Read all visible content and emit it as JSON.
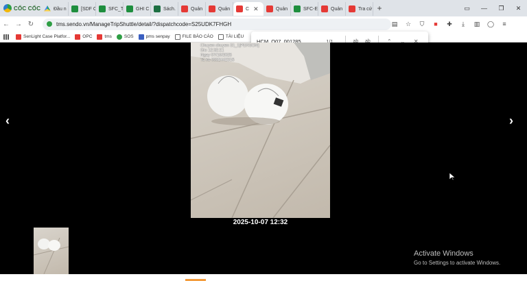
{
  "browser": {
    "brand": "CỐC CỐC",
    "tabs": [
      {
        "label": "Đầu n",
        "favicon": "drive-icon",
        "active": false
      },
      {
        "label": "[SDF C",
        "favicon": "sheets-icon",
        "active": false
      },
      {
        "label": "SFC_T",
        "favicon": "sheets-icon",
        "active": false
      },
      {
        "label": "GHI C",
        "favicon": "sheets-icon",
        "active": false
      },
      {
        "label": "Sách.",
        "favicon": "excel-icon",
        "active": false
      },
      {
        "label": "Quản",
        "favicon": "sendo-icon",
        "active": false
      },
      {
        "label": "Quản",
        "favicon": "sendo-icon",
        "active": false
      },
      {
        "label": "C",
        "favicon": "sendo-icon",
        "active": true
      },
      {
        "label": "Quản",
        "favicon": "sendo-icon",
        "active": false
      },
      {
        "label": "SFC-E",
        "favicon": "sheets-icon",
        "active": false
      },
      {
        "label": "Quản",
        "favicon": "sendo-icon",
        "active": false
      },
      {
        "label": "Tra cứ",
        "favicon": "sendo-icon",
        "active": false
      }
    ],
    "url": "tms.sendo.vn/ManageTripShuttle/detail/?dispatchcode=S25UDK7FHGH",
    "bookmarks": [
      {
        "label": "",
        "icon": "apps-grid-icon"
      },
      {
        "label": "SenLight Case Platfor...",
        "icon": "sendo-icon"
      },
      {
        "label": "OPC",
        "icon": "sendo-icon"
      },
      {
        "label": "tms",
        "icon": "sendo-icon"
      },
      {
        "label": "SOS",
        "icon": "spotify-icon"
      },
      {
        "label": "pms senpay",
        "icon": "senpay-icon"
      },
      {
        "label": "FILE BÁO CÁO",
        "icon": "folder-icon"
      },
      {
        "label": "TÀI LIỆU",
        "icon": "folder-icon"
      }
    ]
  },
  "find": {
    "query": "HCM_Q07_001285",
    "count": "1/1",
    "match_case": "ab",
    "whole_word": "ab"
  },
  "viewer": {
    "watermark": [
      "Chuyen chuyen 31_1[PERSON]",
      "Gio 12:32:21",
      "Ngay 07/10/2025",
      "Ta ke 0332442316"
    ],
    "timestamp": "2025-10-07 12:32",
    "prev": "‹",
    "next": "›"
  },
  "os": {
    "activate_title": "Activate Windows",
    "activate_sub": "Go to Settings to activate Windows."
  },
  "colors": {
    "brand_green": "#2e9e44",
    "sendo_red": "#e53935",
    "tabstrip_bg": "#dfe3e8"
  }
}
